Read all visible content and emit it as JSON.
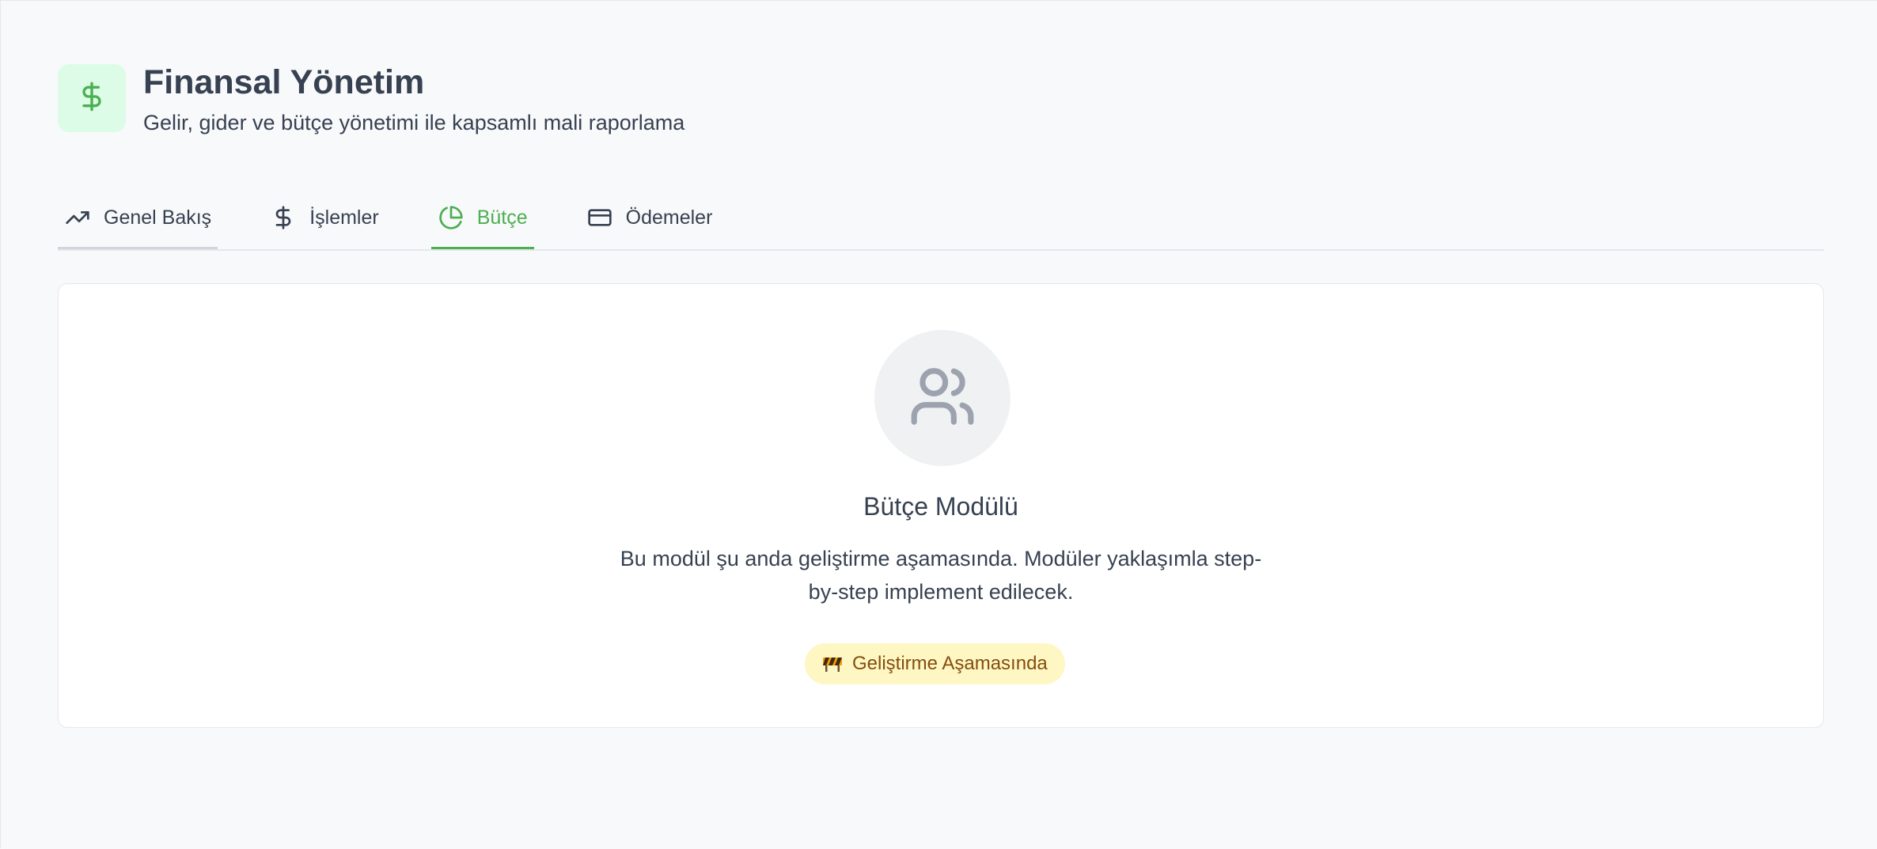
{
  "header": {
    "title": "Finansal Yönetim",
    "subtitle": "Gelir, gider ve bütçe yönetimi ile kapsamlı mali raporlama",
    "icon": "dollar-icon"
  },
  "tabs": [
    {
      "label": "Genel Bakış",
      "icon": "trending-up-icon",
      "active": false
    },
    {
      "label": "İşlemler",
      "icon": "dollar-icon",
      "active": false
    },
    {
      "label": "Bütçe",
      "icon": "pie-chart-icon",
      "active": true
    },
    {
      "label": "Ödemeler",
      "icon": "credit-card-icon",
      "active": false
    }
  ],
  "module": {
    "icon": "users-icon",
    "title": "Bütçe Modülü",
    "description": "Bu modül şu anda geliştirme aşamasında. Modüler yaklaşımla step-by-step implement edilecek.",
    "badge": "Geliştirme Aşamasında",
    "badge_icon": "construction-barrier-icon"
  },
  "colors": {
    "accent": "#4caf50",
    "accent_bg": "#dcfce7",
    "badge_bg": "#fef7c3",
    "badge_text": "#854d0e",
    "text": "#374151",
    "page_bg": "#f8f9fb"
  }
}
